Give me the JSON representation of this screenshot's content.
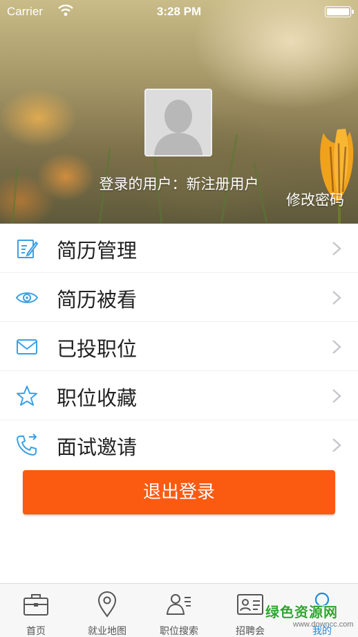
{
  "status_bar": {
    "carrier": "Carrier",
    "time": "3:28 PM",
    "icons": [
      "wifi-icon",
      "battery-icon"
    ]
  },
  "profile": {
    "user_line": "登录的用户：新注册用户",
    "change_password": "修改密码"
  },
  "menu": {
    "items": [
      {
        "label": "简历管理",
        "icon": "edit-document-icon"
      },
      {
        "label": "简历被看",
        "icon": "eye-icon"
      },
      {
        "label": "已投职位",
        "icon": "envelope-icon"
      },
      {
        "label": "职位收藏",
        "icon": "star-icon"
      },
      {
        "label": "面试邀请",
        "icon": "phone-icon"
      }
    ]
  },
  "logout_label": "退出登录",
  "tabbar": {
    "tabs": [
      {
        "label": "首页",
        "icon": "briefcase-icon",
        "active": false
      },
      {
        "label": "就业地图",
        "icon": "map-pin-icon",
        "active": false
      },
      {
        "label": "职位搜索",
        "icon": "person-list-icon",
        "active": false
      },
      {
        "label": "招聘会",
        "icon": "id-card-icon",
        "active": false
      },
      {
        "label": "我的",
        "icon": "user-icon",
        "active": true
      }
    ]
  },
  "watermark": {
    "main": "绿色资源网",
    "sub": "www.downcc.com"
  },
  "colors": {
    "accent": "#1a8be0",
    "logout_button": "#fb5a11",
    "icon_blue": "#3aa0e6"
  }
}
